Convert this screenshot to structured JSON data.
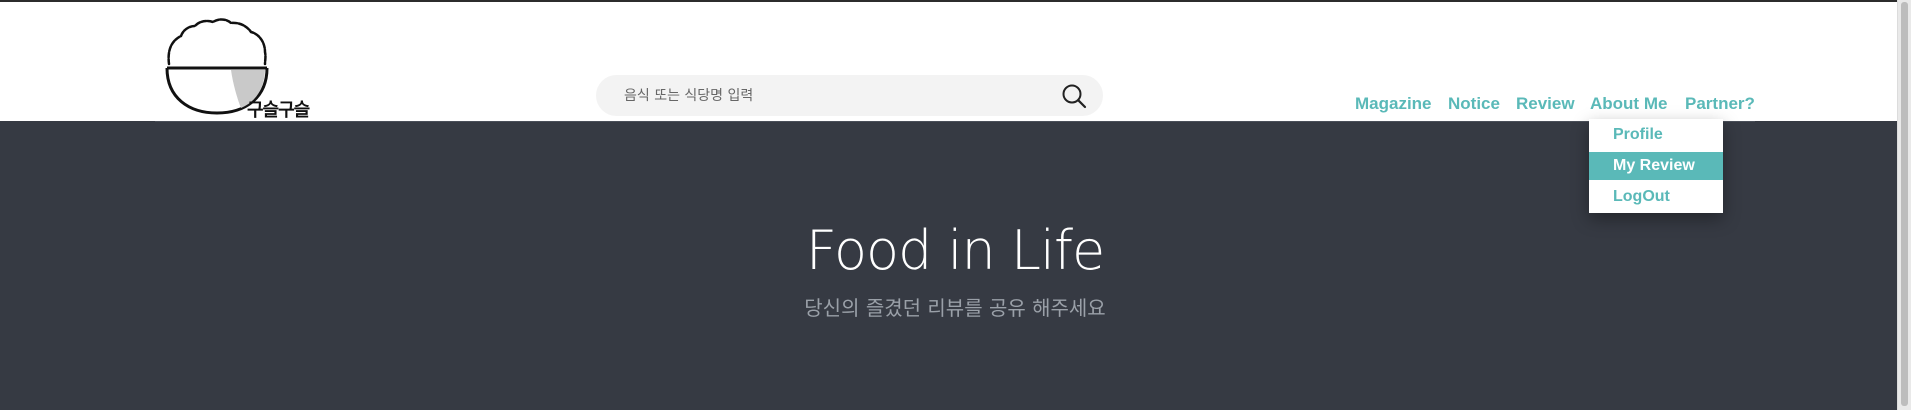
{
  "brand": {
    "logo_text": "구슬구슬"
  },
  "search": {
    "placeholder": "음식 또는 식당명 입력"
  },
  "nav": {
    "items": [
      {
        "label": "Magazine"
      },
      {
        "label": "Notice"
      },
      {
        "label": "Review"
      },
      {
        "label": "About Me"
      },
      {
        "label": "Partner?"
      }
    ]
  },
  "dropdown": {
    "items": [
      {
        "label": "Profile"
      },
      {
        "label": "My Review"
      },
      {
        "label": "LogOut"
      }
    ],
    "active_label": "My Review"
  },
  "hero": {
    "title": "Food in Life",
    "subtitle": "당신의 즐겼던 리뷰를 공유 해주세요"
  },
  "colors": {
    "accent": "#5ab9b8",
    "hero_bg": "#363a43",
    "subtitle": "#9aa0a8"
  },
  "icons": {
    "search": "search-icon",
    "logo": "rice-bowl-logo-icon"
  }
}
